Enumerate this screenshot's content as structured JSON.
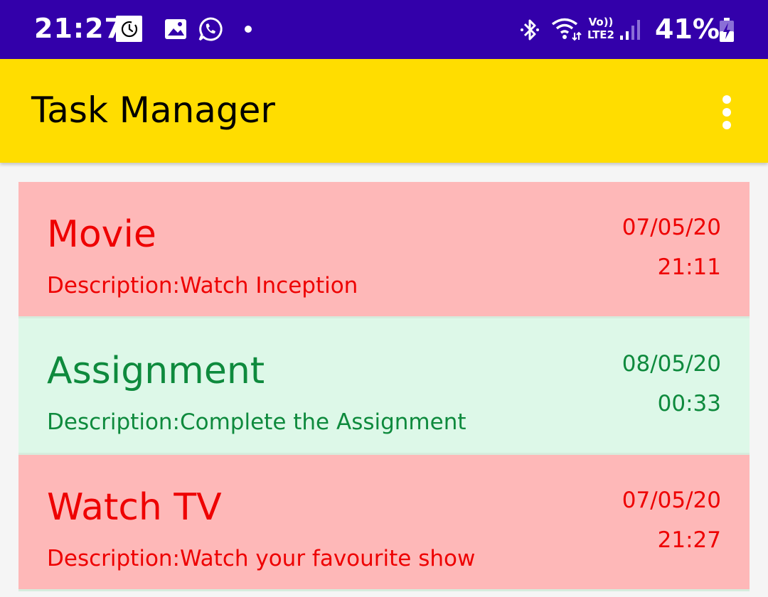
{
  "status_bar": {
    "time": "21:27",
    "network": {
      "volte_top": "Vo))",
      "volte_bottom": "LTE2"
    },
    "battery_text": "41%"
  },
  "app_bar": {
    "title": "Task Manager",
    "colors": {
      "background": "#ffdd00",
      "status_bar": "#3300aa"
    }
  },
  "tasks": [
    {
      "title": "Movie",
      "description": "Description:Watch Inception",
      "date": "07/05/20",
      "time": "21:11",
      "state": "red"
    },
    {
      "title": "Assignment",
      "description": "Description:Complete the Assignment",
      "date": "08/05/20",
      "time": "00:33",
      "state": "green"
    },
    {
      "title": "Watch TV",
      "description": "Description:Watch your favourite show",
      "date": "07/05/20",
      "time": "21:27",
      "state": "red"
    }
  ],
  "colors": {
    "red_card_bg": "#feb8b8",
    "red_text": "#ee0000",
    "green_card_bg": "#ddf8e8",
    "green_text": "#0e8a3d"
  }
}
